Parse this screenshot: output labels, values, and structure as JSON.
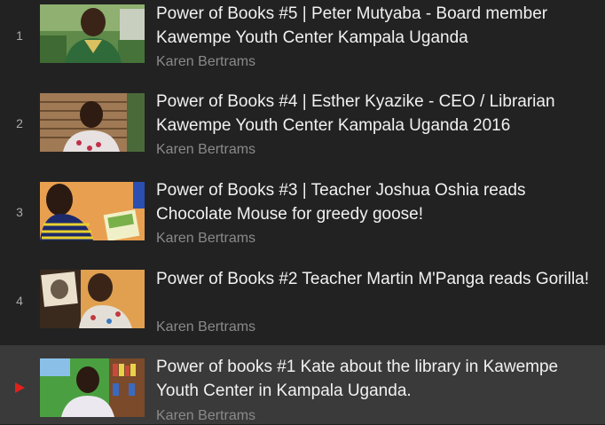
{
  "playlist": {
    "items": [
      {
        "index": "1",
        "title": "Power of Books #5 | Peter Mutyaba - Board member Kawempe Youth Center Kampala Uganda",
        "author": "Karen Bertrams",
        "thumbnail": "man-green-shirt-garden"
      },
      {
        "index": "2",
        "title": "Power of Books #4 | Esther Kyazike - CEO / Librarian Kawempe Youth Center Kampala Uganda 2016",
        "author": "Karen Bertrams",
        "thumbnail": "woman-brick-wall"
      },
      {
        "index": "3",
        "title": "Power of Books #3 | Teacher Joshua Oshia reads Chocolate Mouse for greedy goose!",
        "author": "Karen Bertrams",
        "thumbnail": "man-holding-book"
      },
      {
        "index": "4",
        "title": "Power of Books #2 Teacher Martin M'Panga reads Gorilla!",
        "author": "Karen Bertrams",
        "thumbnail": "man-showing-picture-book"
      },
      {
        "index": "",
        "title": "Power of books #1 Kate about the library in Kawempe Youth Center in Kampala Uganda.",
        "author": "Karen Bertrams",
        "thumbnail": "girl-bookshelf",
        "now_playing": true
      }
    ]
  },
  "colors": {
    "background": "#222222",
    "active_row": "#3a3a3a",
    "title": "#f1f1f1",
    "author": "#8a8a8a",
    "play_indicator": "#e0221b"
  }
}
